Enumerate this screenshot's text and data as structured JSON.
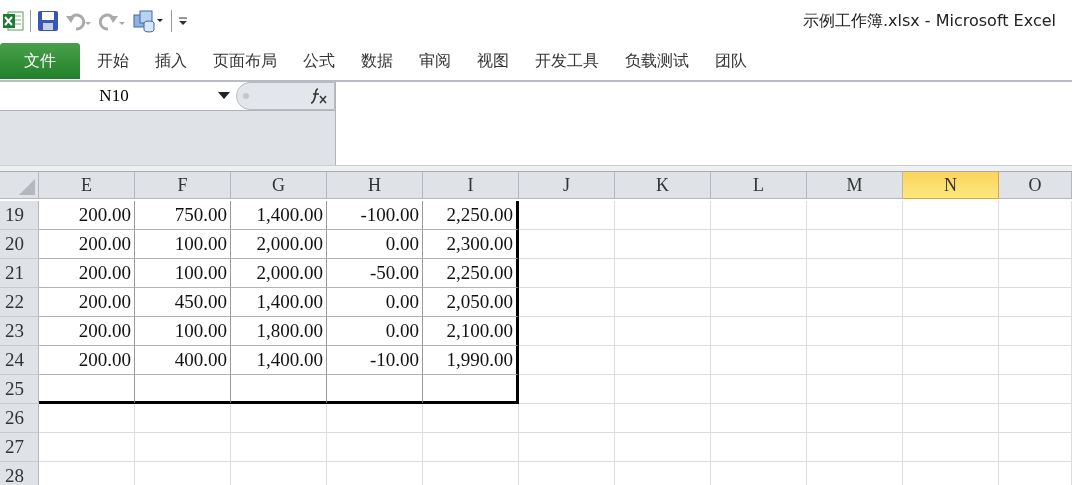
{
  "window": {
    "title": "示例工作簿.xlsx - Microsoft Excel"
  },
  "ribbon_tabs": [
    {
      "label": "文件",
      "kind": "file"
    },
    {
      "label": "开始",
      "kind": "tab"
    },
    {
      "label": "插入",
      "kind": "tab"
    },
    {
      "label": "页面布局",
      "kind": "tab"
    },
    {
      "label": "公式",
      "kind": "tab"
    },
    {
      "label": "数据",
      "kind": "tab"
    },
    {
      "label": "审阅",
      "kind": "tab"
    },
    {
      "label": "视图",
      "kind": "tab"
    },
    {
      "label": "开发工具",
      "kind": "tab"
    },
    {
      "label": "负载测试",
      "kind": "tab"
    },
    {
      "label": "团队",
      "kind": "tab"
    }
  ],
  "name_box": {
    "value": "N10"
  },
  "sheet": {
    "columns": [
      {
        "label": "E",
        "selected": false
      },
      {
        "label": "F",
        "selected": false
      },
      {
        "label": "G",
        "selected": false
      },
      {
        "label": "H",
        "selected": false
      },
      {
        "label": "I",
        "selected": false
      },
      {
        "label": "J",
        "selected": false
      },
      {
        "label": "K",
        "selected": false
      },
      {
        "label": "L",
        "selected": false
      },
      {
        "label": "M",
        "selected": false
      },
      {
        "label": "N",
        "selected": true
      },
      {
        "label": "O",
        "selected": false
      }
    ],
    "rows": [
      {
        "header": "19",
        "outlined": true,
        "cells": [
          "200.00",
          "750.00",
          "1,400.00",
          "-100.00",
          "2,250.00"
        ]
      },
      {
        "header": "20",
        "outlined": true,
        "cells": [
          "200.00",
          "100.00",
          "2,000.00",
          "0.00",
          "2,300.00"
        ]
      },
      {
        "header": "21",
        "outlined": true,
        "cells": [
          "200.00",
          "100.00",
          "2,000.00",
          "-50.00",
          "2,250.00"
        ]
      },
      {
        "header": "22",
        "outlined": true,
        "cells": [
          "200.00",
          "450.00",
          "1,400.00",
          "0.00",
          "2,050.00"
        ]
      },
      {
        "header": "23",
        "outlined": true,
        "cells": [
          "200.00",
          "100.00",
          "1,800.00",
          "0.00",
          "2,100.00"
        ]
      },
      {
        "header": "24",
        "outlined": true,
        "cells": [
          "200.00",
          "400.00",
          "1,400.00",
          "-10.00",
          "1,990.00"
        ]
      },
      {
        "header": "25",
        "outlined": true,
        "cells": []
      },
      {
        "header": "26",
        "outlined": false,
        "cells": []
      },
      {
        "header": "27",
        "outlined": false,
        "cells": []
      },
      {
        "header": "28",
        "outlined": false,
        "cells": []
      }
    ]
  }
}
